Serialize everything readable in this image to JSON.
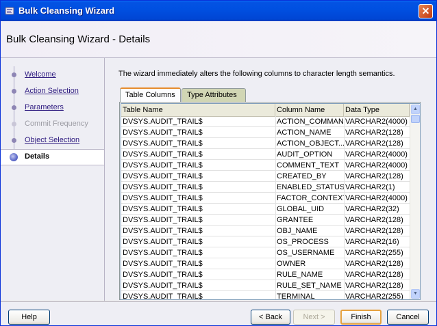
{
  "window": {
    "title": "Bulk Cleansing Wizard"
  },
  "header": {
    "title": "Bulk Cleansing Wizard - Details"
  },
  "steps": [
    {
      "label": "Welcome",
      "state": "link"
    },
    {
      "label": "Action Selection",
      "state": "link"
    },
    {
      "label": "Parameters",
      "state": "link"
    },
    {
      "label": "Commit Frequency",
      "state": "disabled"
    },
    {
      "label": "Object Selection",
      "state": "link"
    },
    {
      "label": "Details",
      "state": "active"
    }
  ],
  "content": {
    "description": "The wizard immediately alters the following columns to character length semantics.",
    "tabs": [
      {
        "label": "Table Columns",
        "active": true
      },
      {
        "label": "Type Attributes",
        "active": false
      }
    ]
  },
  "table": {
    "headers": [
      "Table Name",
      "Column Name",
      "Data Type"
    ],
    "rows": [
      [
        "DVSYS.AUDIT_TRAIL$",
        "ACTION_COMMAND",
        "VARCHAR2(4000)"
      ],
      [
        "DVSYS.AUDIT_TRAIL$",
        "ACTION_NAME",
        "VARCHAR2(128)"
      ],
      [
        "DVSYS.AUDIT_TRAIL$",
        "ACTION_OBJECT...",
        "VARCHAR2(128)"
      ],
      [
        "DVSYS.AUDIT_TRAIL$",
        "AUDIT_OPTION",
        "VARCHAR2(4000)"
      ],
      [
        "DVSYS.AUDIT_TRAIL$",
        "COMMENT_TEXT",
        "VARCHAR2(4000)"
      ],
      [
        "DVSYS.AUDIT_TRAIL$",
        "CREATED_BY",
        "VARCHAR2(128)"
      ],
      [
        "DVSYS.AUDIT_TRAIL$",
        "ENABLED_STATUS",
        "VARCHAR2(1)"
      ],
      [
        "DVSYS.AUDIT_TRAIL$",
        "FACTOR_CONTEXT",
        "VARCHAR2(4000)"
      ],
      [
        "DVSYS.AUDIT_TRAIL$",
        "GLOBAL_UID",
        "VARCHAR2(32)"
      ],
      [
        "DVSYS.AUDIT_TRAIL$",
        "GRANTEE",
        "VARCHAR2(128)"
      ],
      [
        "DVSYS.AUDIT_TRAIL$",
        "OBJ_NAME",
        "VARCHAR2(128)"
      ],
      [
        "DVSYS.AUDIT_TRAIL$",
        "OS_PROCESS",
        "VARCHAR2(16)"
      ],
      [
        "DVSYS.AUDIT_TRAIL$",
        "OS_USERNAME",
        "VARCHAR2(255)"
      ],
      [
        "DVSYS.AUDIT_TRAIL$",
        "OWNER",
        "VARCHAR2(128)"
      ],
      [
        "DVSYS.AUDIT_TRAIL$",
        "RULE_NAME",
        "VARCHAR2(128)"
      ],
      [
        "DVSYS.AUDIT_TRAIL$",
        "RULE_SET_NAME",
        "VARCHAR2(128)"
      ],
      [
        "DVSYS.AUDIT_TRAIL$",
        "TERMINAL",
        "VARCHAR2(255)"
      ]
    ]
  },
  "footer": {
    "help": "Help",
    "back": "< Back",
    "next": "Next >",
    "finish": "Finish",
    "cancel": "Cancel"
  },
  "icons": {
    "window": "wizard-app-icon",
    "close": "close-icon",
    "scroll_up": "scroll-up-arrow-icon",
    "scroll_down": "scroll-down-arrow-icon"
  }
}
